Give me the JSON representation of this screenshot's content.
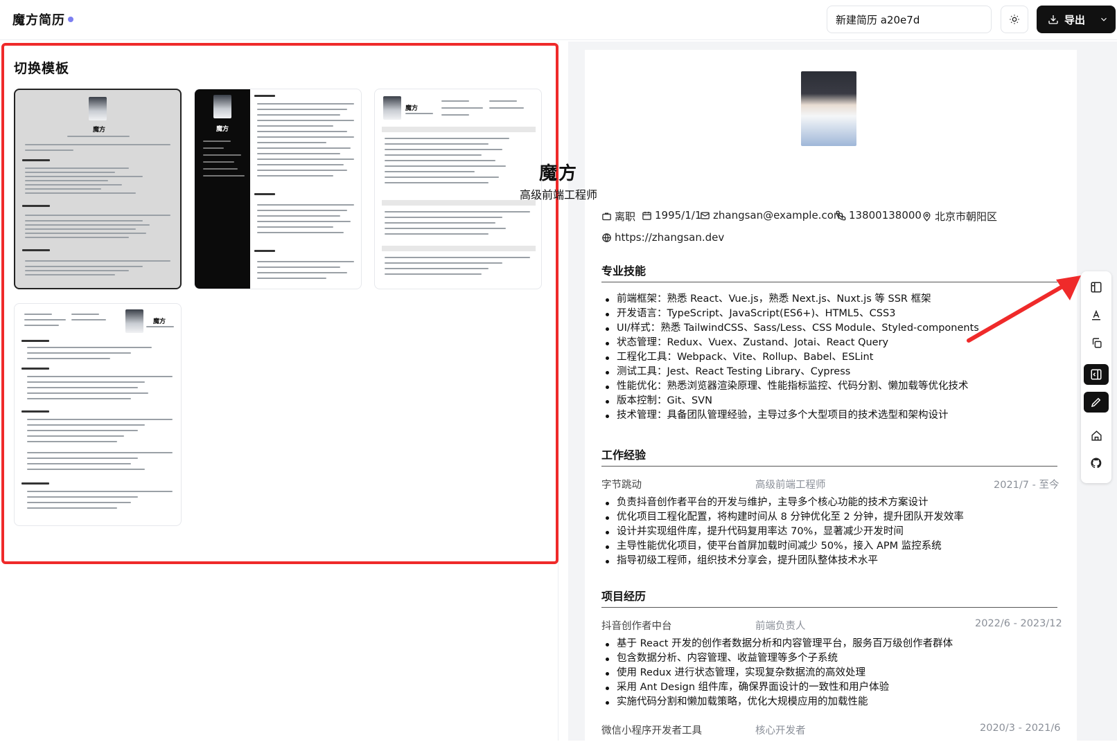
{
  "header": {
    "app_title": "魔方简历",
    "resume_name": "新建简历 a20e7d",
    "export_label": "导出"
  },
  "templates_panel": {
    "title": "切换模板",
    "mini_name": "魔方",
    "mini_role": "高级前端工程师"
  },
  "resume": {
    "name": "魔方",
    "role": "高级前端工程师",
    "info": {
      "status": "离职",
      "birth": "1995/1/1",
      "email": "zhangsan@example.com",
      "phone": "13800138000",
      "location": "北京市朝阳区",
      "site": "https://zhangsan.dev"
    },
    "skills": {
      "title": "专业技能",
      "items": [
        "前端框架：熟悉 React、Vue.js，熟悉 Next.js、Nuxt.js 等 SSR 框架",
        "开发语言：TypeScript、JavaScript(ES6+)、HTML5、CSS3",
        "UI/样式：熟悉 TailwindCSS、Sass/Less、CSS Module、Styled-components",
        "状态管理：Redux、Vuex、Zustand、Jotai、React Query",
        "工程化工具：Webpack、Vite、Rollup、Babel、ESLint",
        "测试工具：Jest、React Testing Library、Cypress",
        "性能优化：熟悉浏览器渲染原理、性能指标监控、代码分割、懒加载等优化技术",
        "版本控制：Git、SVN",
        "技术管理：具备团队管理经验，主导过多个大型项目的技术选型和架构设计"
      ]
    },
    "work": {
      "title": "工作经验",
      "company": "字节跳动",
      "position": "高级前端工程师",
      "date": "2021/7 - 至今",
      "items": [
        "负责抖音创作者平台的开发与维护，主导多个核心功能的技术方案设计",
        "优化项目工程化配置，将构建时间从 8 分钟优化至 2 分钟，提升团队开发效率",
        "设计并实现组件库，提升代码复用率达 70%，显著减少开发时间",
        "主导性能优化项目，使平台首屏加载时间减少 50%，接入 APM 监控系统",
        "指导初级工程师，组织技术分享会，提升团队整体技术水平"
      ]
    },
    "projects": {
      "title": "项目经历",
      "p1_name": "抖音创作者中台",
      "p1_role": "前端负责人",
      "p1_date": "2022/6 - 2023/12",
      "p1_items": [
        "基于 React 开发的创作者数据分析和内容管理平台，服务百万级创作者群体",
        "包含数据分析、内容管理、收益管理等多个子系统",
        "使用 Redux 进行状态管理，实现复杂数据流的高效处理",
        "采用 Ant Design 组件库，确保界面设计的一致性和用户体验",
        "实施代码分割和懒加载策略，优化大规模应用的加载性能"
      ],
      "p2_name": "微信小程序开发者工具",
      "p2_role": "核心开发者",
      "p2_date": "2020/3 - 2021/6"
    }
  },
  "colors": {
    "accent_dot": "#7c7ff0",
    "highlight": "#ef2a2a",
    "dark_button": "#111111"
  },
  "icons": [
    "sun-icon",
    "download-icon",
    "chevron-down-icon",
    "briefcase-icon",
    "calendar-icon",
    "mail-icon",
    "phone-icon",
    "map-pin-icon",
    "globe-icon",
    "layout-icon",
    "text-icon",
    "copy-icon",
    "panel-icon",
    "pencil-icon",
    "home-icon",
    "github-icon"
  ]
}
